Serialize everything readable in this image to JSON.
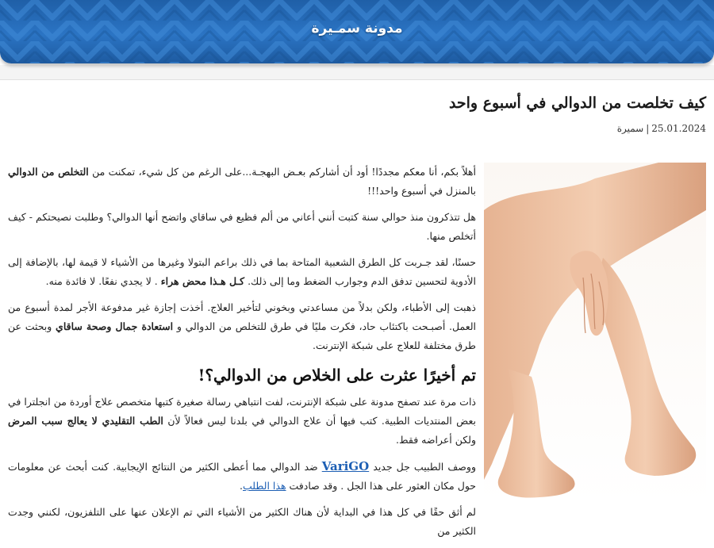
{
  "site": {
    "title": "مدونة سمـيرة"
  },
  "post": {
    "title": "كيف تخلصت من الدوالي في أسبوع واحد",
    "date": "25.01.2024",
    "author": "سميرة"
  },
  "paragraphs": {
    "p1": {
      "a": "أهلاً بكم، أنا معكم مجددًا! أود أن أشاركم بعـض البهجـة...على الرغم من كل شيء، تمكنت من ",
      "b": "التخلص من الدوالي",
      "c": " بالمنزل في أسبوع واحد!!!"
    },
    "p2": "هل تتذكرون منذ حوالي سنة كتبت أنني أعاني من ألم فظيع في ساقاي واتضح أنها الدوالي؟ وطلبت نصيحتكم - كيف أتخلص منها.",
    "p3": {
      "a": "حسنًا، لقد جـربت كل الطرق الشعبية المتاحة بما في ذلك براعم البتولا وغيرها من الأشياء لا قيمة لها، بالإضافة إلى الأدوية لتحسين تدفق الدم وجوارب الضغط وما إلى ذلك. ",
      "b": "كـل هـذا محض هراء",
      "c": " . لا يجدي نفعًا. لا فائدة منه."
    },
    "p4": {
      "a": "ذهبت إلى الأطباء، ولكن بدلاً من مساعدتي وبخوني لتأخير العلاج. أخذت إجازة غير مدفوعة الأجر لمدة أسبوع من العمل. أصبـحت باكتئاب حاد، فكرت مليًا في طرق للتخلص من الدوالي و ",
      "b": "استعادة جمال وصحة ساقاي",
      "c": " وبحثت عن طرق مختلفة للعلاج على شبكة الإنترنت."
    },
    "heading": "تم أخيرًا عثرت على الخلاص من الدوالي؟!",
    "p5": {
      "a": "ذات مرة عند تصفح مدونة على شبكة الإنترنت، لفت انتباهي رسالة صغيرة كتبها متخصص علاج أوردة من انجلترا في بعض المنتديات الطبية. كتب فيها أن علاج الدوالي في بلدنا ليس فعالاً لأن ",
      "b": "الطب التقليدي لا يعالج سبب المرض",
      "c": " ولكن أعراضه فقط."
    },
    "p6": {
      "a": "ووصف الطبيب جل جديد ",
      "brand": "VariGO",
      "b": " ضد الدوالي مما أعطى الكثير من النتائج الإيجابية. كنت أبحث عن معلومات حول مكان العثور على هذا الجل . وقد صادفت ",
      "link": "هذا الطلب",
      "c": "."
    },
    "p7": "لم أثق حقًا في كل هذا في البداية لأن هناك الكثير من الأشياء التي تم الإعلان عنها على التلفزيون، لكنني وجدت الكثير من"
  },
  "image": {
    "alt": "legs-photo"
  }
}
